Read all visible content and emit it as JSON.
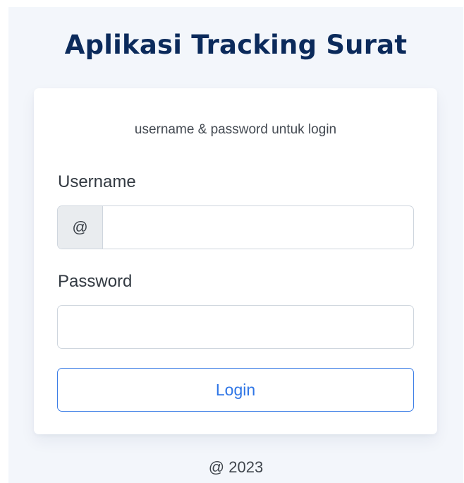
{
  "app": {
    "title": "Aplikasi Tracking Surat"
  },
  "login": {
    "instruction": "username & password untuk login",
    "username_label": "Username",
    "username_addon": "@",
    "username_value": "",
    "password_label": "Password",
    "password_value": "",
    "button_label": "Login"
  },
  "footer": {
    "text": "@ 2023"
  },
  "colors": {
    "title": "#0b2a5b",
    "primary": "#2f76e6",
    "background": "#f3f6fb"
  }
}
